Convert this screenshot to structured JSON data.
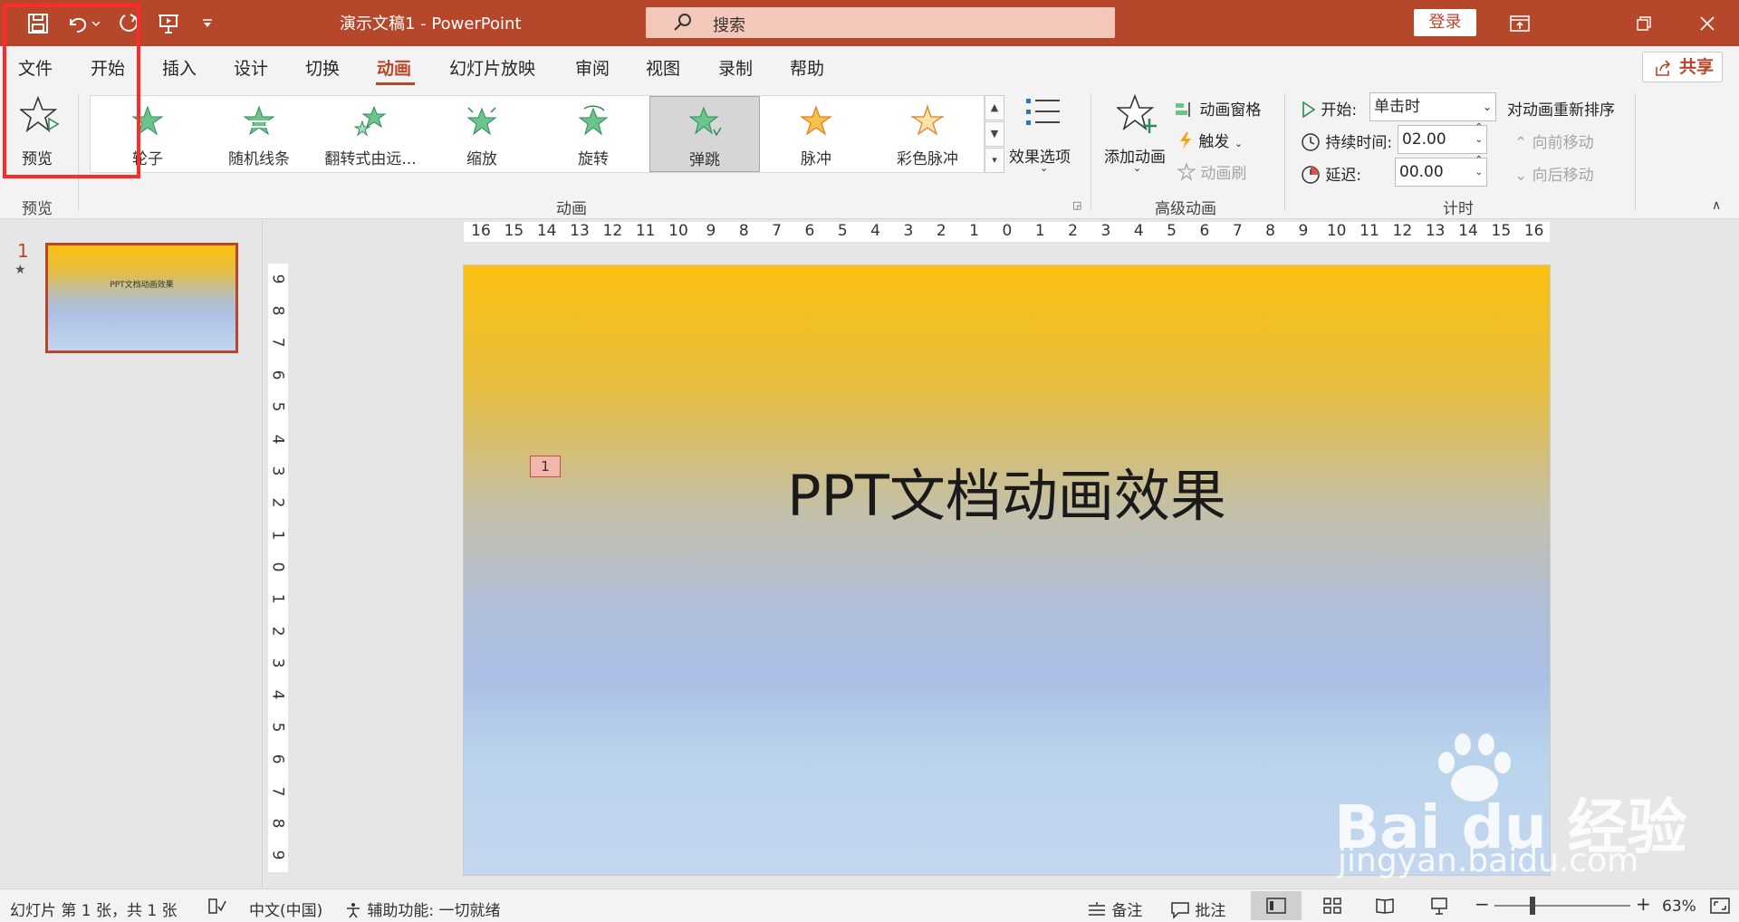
{
  "titlebar": {
    "doc_title": "演示文稿1  -  PowerPoint",
    "search_placeholder": "搜索",
    "login_label": "登录"
  },
  "tabs": [
    "文件",
    "开始",
    "插入",
    "设计",
    "切换",
    "动画",
    "幻灯片放映",
    "审阅",
    "视图",
    "录制",
    "帮助"
  ],
  "active_tab": "动画",
  "share_label": "共享",
  "ribbon": {
    "preview_label": "预览",
    "preview_group": "预览",
    "animations_group": "动画",
    "animations": [
      "轮子",
      "随机线条",
      "翻转式由远...",
      "缩放",
      "旋转",
      "弹跳",
      "脉冲",
      "彩色脉冲"
    ],
    "selected_animation": "弹跳",
    "effect_options": "效果选项",
    "add_animation": "添加动画",
    "animation_pane": "动画窗格",
    "trigger": "触发",
    "animation_painter": "动画刷",
    "advanced_group": "高级动画",
    "start_label": "开始:",
    "start_value": "单击时",
    "duration_label": "持续时间:",
    "duration_value": "02.00",
    "delay_label": "延迟:",
    "delay_value": "00.00",
    "reorder_label": "对动画重新排序",
    "move_earlier": "向前移动",
    "move_later": "向后移动",
    "timing_group": "计时"
  },
  "slides_panel": {
    "slide_number": "1",
    "thumb_title": "PPT文档动画效果"
  },
  "slide": {
    "title": "PPT文档动画效果",
    "anim_badge": "1"
  },
  "hruler_ticks": [
    "16",
    "15",
    "14",
    "13",
    "12",
    "11",
    "10",
    "9",
    "8",
    "7",
    "6",
    "5",
    "4",
    "3",
    "2",
    "1",
    "0",
    "1",
    "2",
    "3",
    "4",
    "5",
    "6",
    "7",
    "8",
    "9",
    "10",
    "11",
    "12",
    "13",
    "14",
    "15",
    "16"
  ],
  "vruler_ticks": [
    "9",
    "8",
    "7",
    "6",
    "5",
    "4",
    "3",
    "2",
    "1",
    "0",
    "1",
    "2",
    "3",
    "4",
    "5",
    "6",
    "7",
    "8",
    "9"
  ],
  "statusbar": {
    "slide_info": "幻灯片 第 1 张，共 1 张",
    "language": "中文(中国)",
    "accessibility": "辅助功能: 一切就绪",
    "notes": "备注",
    "comments": "批注",
    "zoom": "63%"
  },
  "watermark": {
    "brand": "Bai  du 经验",
    "url": "jingyan.baidu.com"
  },
  "colors": {
    "accent": "#b7472a",
    "highlight_box": "#ff2a2a"
  }
}
